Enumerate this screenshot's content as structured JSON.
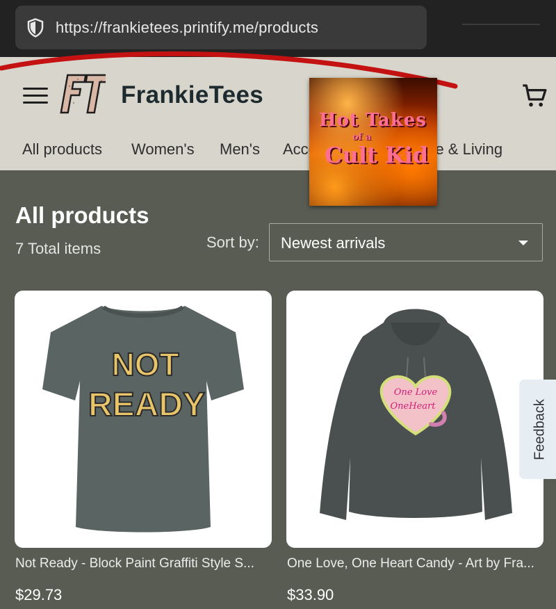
{
  "browser": {
    "url": "https://frankietees.printify.me/products",
    "security_icon": "shield-icon"
  },
  "header": {
    "menu_icon": "hamburger-menu-icon",
    "logo_text": "FT",
    "brand_name": "FrankieTees",
    "cart_icon": "shopping-cart-icon",
    "nav": [
      {
        "label": "All products"
      },
      {
        "label": "Women's"
      },
      {
        "label": "Men's"
      },
      {
        "label": "Accessories"
      },
      {
        "label": "Home & Living"
      }
    ]
  },
  "promo_overlay": {
    "line1": "Hot Takes",
    "line2": "of a",
    "line3": "Cult Kid"
  },
  "main": {
    "title": "All products",
    "total_items": "7 Total items",
    "sort_label": "Sort by:",
    "sort_value": "Newest arrivals"
  },
  "products": [
    {
      "name": "Not Ready - Block Paint Graffiti Style S...",
      "price": "$29.73",
      "graphic_line1": "NOT",
      "graphic_line2": "READY"
    },
    {
      "name": "One Love, One Heart Candy - Art by Fra...",
      "price": "$33.90",
      "graphic_line1": "One Love",
      "graphic_line2": "OneHeart"
    }
  ],
  "feedback": {
    "label": "Feedback"
  },
  "colors": {
    "page_bg": "#585c52",
    "header_bg": "#d8d6cc",
    "annotation_red": "#c41212"
  }
}
